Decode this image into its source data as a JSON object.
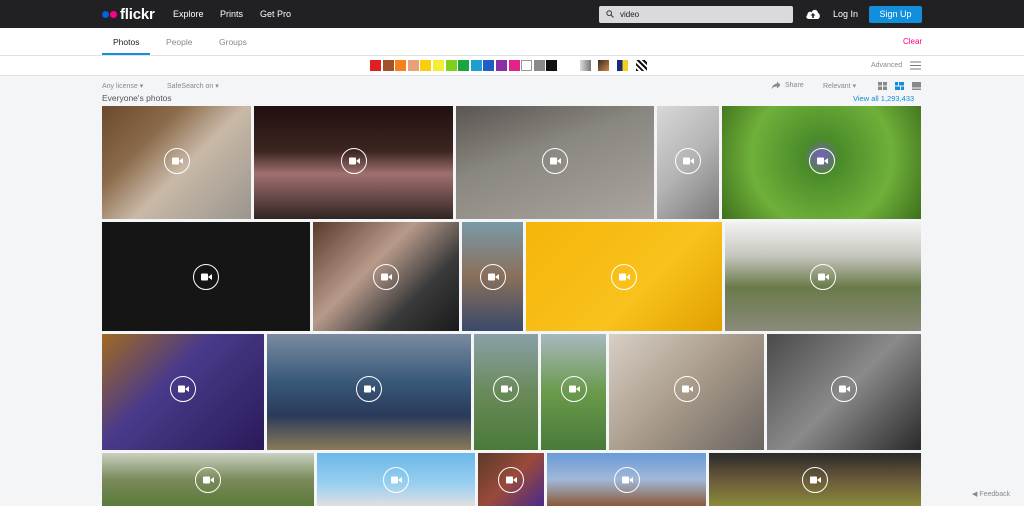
{
  "topbar": {
    "logo_text": "flickr",
    "nav": [
      "Explore",
      "Prints",
      "Get Pro"
    ],
    "search_value": "video",
    "login_label": "Log In",
    "signup_label": "Sign Up"
  },
  "tabs": [
    {
      "label": "Photos",
      "active": true
    },
    {
      "label": "People",
      "active": false
    },
    {
      "label": "Groups",
      "active": false
    }
  ],
  "clear_label": "Clear",
  "advanced_label": "Advanced",
  "colors": [
    "#e02020",
    "#a0522d",
    "#f7801c",
    "#e8a07a",
    "#fbce0a",
    "#f3ed33",
    "#7ed11b",
    "#1aa541",
    "#1f9fce",
    "#1e5ec6",
    "#8b2fa5",
    "#e3238a",
    "#ffffff",
    "#8a8a8a",
    "#111111"
  ],
  "filters": {
    "license": "Any license",
    "safesearch": "SafeSearch on",
    "share": "Share",
    "sort": "Relevant"
  },
  "section_title": "Everyone's photos",
  "view_all": "View all 1,293,433",
  "feedback_label": "Feedback",
  "photos": [
    {
      "bg": "linear-gradient(135deg,#6b4a2d 0%,#8a6a4a 30%,#c9b9a7 55%,#9a958f 100%)"
    },
    {
      "bg": "linear-gradient(180deg,#201010 0%,#3c2520 40%,#a07070 60%,#302522 100%)"
    },
    {
      "bg": "linear-gradient(160deg,#5a5550 0%,#8a8680 40%,#aaa59f 100%)"
    },
    {
      "bg": "linear-gradient(135deg,#d8d8d8 0%,#b4b4b4 50%,#7a7a7a 100%)"
    },
    {
      "bg": "radial-gradient(circle at 50% 45%,#7a5bd0 0%,#4a8b2a 15%,#6fb03a 60%,#3f6f1c 100%)"
    },
    {
      "bg": "#151515"
    },
    {
      "bg": "linear-gradient(135deg,#5a3a2a 0%,#b89a8a 40%,#3a3a3a 70%,#1a1a1a 100%)"
    },
    {
      "bg": "linear-gradient(180deg,#7a9aa8 0%,#8a6f5a 50%,#3a4a6a 100%)"
    },
    {
      "bg": "linear-gradient(135deg,#f5b50a 0%,#f9c21c 60%,#e0a000 100%)"
    },
    {
      "bg": "linear-gradient(180deg,#f2f2f2 0%,#c8c8c0 30%,#6a7a4a 60%,#8a8a7a 100%)"
    },
    {
      "bg": "linear-gradient(135deg,#a06a20 0%,#4a3a8a 40%,#2a1a5a 100%)"
    },
    {
      "bg": "linear-gradient(180deg,#7a8ba0 0%,#3a5a7a 40%,#2a3a5a 70%,#8a7a5a 100%)"
    },
    {
      "bg": "linear-gradient(180deg,#8aa0a8 0%,#6a8a5a 50%,#4a7a3a 100%)"
    },
    {
      "bg": "linear-gradient(180deg,#a8b8c0 0%,#6a9a4a 50%,#4a7a3a 100%)"
    },
    {
      "bg": "linear-gradient(135deg,#d8cfc5 0%,#a89a8a 50%,#6a6460 100%)"
    },
    {
      "bg": "linear-gradient(135deg,#4a4a4a 0%,#8a8a8a 50%,#2a2a2a 100%)"
    },
    {
      "bg": "linear-gradient(180deg,#c8d0c0 0%,#7a8a5a 50%,#5a7a3a 100%)"
    },
    {
      "bg": "linear-gradient(180deg,#6ab8e8 0%,#9ad0f0 60%,#e0e0e0 100%)"
    },
    {
      "bg": "linear-gradient(135deg,#5a3a2a 0%,#9a4a3a 50%,#4a2a8a 100%)"
    },
    {
      "bg": "linear-gradient(180deg,#6a9ad8 0%,#a0b8d8 50%,#8a5a3a 100%)"
    },
    {
      "bg": "linear-gradient(180deg,#2a2a2a 0%,#6a5a3a 50%,#8a8a3a 100%)"
    }
  ]
}
